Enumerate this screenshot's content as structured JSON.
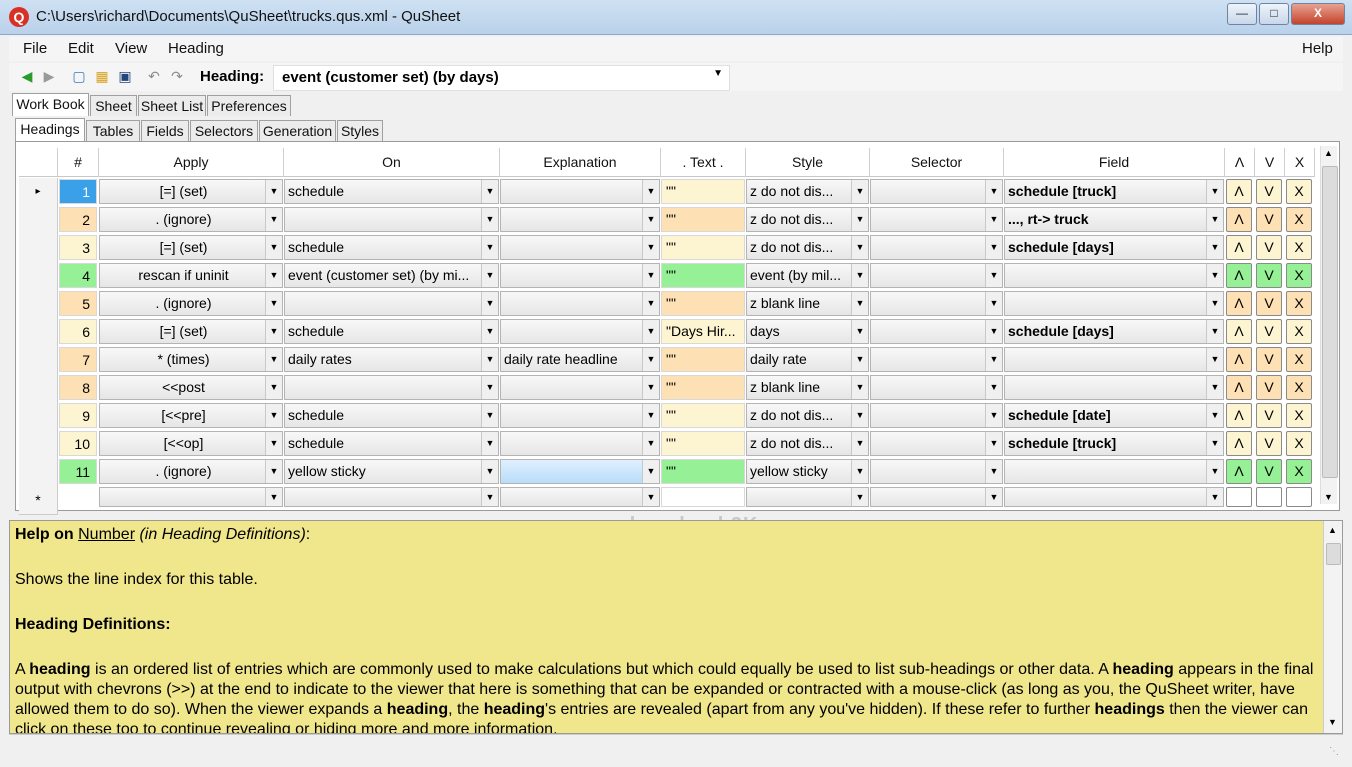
{
  "window": {
    "title": "C:\\Users\\richard\\Documents\\QuSheet\\trucks.qus.xml - QuSheet",
    "min": "—",
    "max": "□",
    "close": "X"
  },
  "app_icon": "Q",
  "menu": {
    "file": "File",
    "edit": "Edit",
    "view": "View",
    "heading": "Heading",
    "help": "Help"
  },
  "toolbar": {
    "icons": [
      "back-arrow-icon",
      "forward-arrow-icon",
      "new-file-icon",
      "open-folder-icon",
      "save-disk-icon",
      "undo-icon",
      "redo-icon"
    ],
    "heading_label": "Heading:",
    "heading_value": "event (customer set) (by days)"
  },
  "tabs_top": [
    "Work Book",
    "Sheet",
    "Sheet List",
    "Preferences"
  ],
  "tabs_sub": [
    "Headings",
    "Tables",
    "Fields",
    "Selectors",
    "Generation",
    "Styles"
  ],
  "grid": {
    "columns": [
      "#",
      "Apply",
      "On",
      "Explanation",
      ". Text .",
      "Style",
      "Selector",
      "Field",
      "Λ",
      "V",
      "X"
    ],
    "rows": [
      {
        "num": "1",
        "apply": "[=] (set)",
        "on": "schedule",
        "expl": "",
        "text": "\"\"",
        "style": "z do not dis...",
        "sel": "",
        "field": "schedule [truck]",
        "color": "yellow"
      },
      {
        "num": "2",
        "apply": ". (ignore)",
        "on": "",
        "expl": "",
        "text": "\"\"",
        "style": "z do not dis...",
        "sel": "",
        "field": "..., rt-> truck",
        "color": "orange"
      },
      {
        "num": "3",
        "apply": "[=] (set)",
        "on": "schedule",
        "expl": "",
        "text": "\"\"",
        "style": "z do not dis...",
        "sel": "",
        "field": "schedule [days]",
        "color": "yellow"
      },
      {
        "num": "4",
        "apply": "rescan if uninit",
        "on": "event (customer set) (by mi...",
        "expl": "",
        "text": "\"\"",
        "style": "event (by mil...",
        "sel": "",
        "field": "",
        "color": "green"
      },
      {
        "num": "5",
        "apply": ". (ignore)",
        "on": "",
        "expl": "",
        "text": "\"\"",
        "style": "z blank line",
        "sel": "",
        "field": "",
        "color": "orange"
      },
      {
        "num": "6",
        "apply": "[=] (set)",
        "on": "schedule",
        "expl": "",
        "text": "\"Days Hir...",
        "style": "days",
        "sel": "",
        "field": "schedule [days]",
        "color": "yellow"
      },
      {
        "num": "7",
        "apply": "* (times)",
        "on": "daily rates",
        "expl": "daily rate headline",
        "text": "\"\"",
        "style": "daily rate",
        "sel": "",
        "field": "",
        "color": "orange"
      },
      {
        "num": "8",
        "apply": "<<post",
        "on": "",
        "expl": "",
        "text": "\"\"",
        "style": "z blank line",
        "sel": "",
        "field": "",
        "color": "orange"
      },
      {
        "num": "9",
        "apply": "[<<pre]",
        "on": "schedule",
        "expl": "",
        "text": "\"\"",
        "style": "z do not dis...",
        "sel": "",
        "field": "schedule [date]",
        "color": "yellow"
      },
      {
        "num": "10",
        "apply": "[<<op]",
        "on": "schedule",
        "expl": "",
        "text": "\"\"",
        "style": "z do not dis...",
        "sel": "",
        "field": "schedule [truck]",
        "color": "yellow"
      },
      {
        "num": "11",
        "apply": ". (ignore)",
        "on": "yellow sticky",
        "expl": "",
        "text": "\"\"",
        "style": "yellow sticky",
        "sel": "",
        "field": "",
        "color": "green"
      }
    ],
    "new_row_marker": "*",
    "current_row_marker": "▸",
    "btn_up": "Λ",
    "btn_down": "V",
    "btn_delete": "X"
  },
  "colors": {
    "yellow": "#fdf5d2",
    "orange": "#fde0b4",
    "green": "#96f096",
    "selected_num": "#3aa0e8",
    "help_bg": "#f0e68c"
  },
  "watermark": "download 3K",
  "help": {
    "title_prefix": "Help on ",
    "title_link": "Number",
    "title_italic": " (in Heading Definitions)",
    "title_colon": ":",
    "line1": "Shows the line index for this table.",
    "section": "Heading Definitions:",
    "para_a1": "A ",
    "para_b1": "heading",
    "para_a2": " is an ordered list of entries which are commonly used to make calculations but which could equally be used to list sub-headings or other data. A ",
    "para_b2": "heading",
    "para_a3": " appears in the final output with chevrons (>>) at the end to indicate to the viewer that here is something that can be expanded or contracted with a mouse-click (as long as you, the QuSheet writer, have allowed them to do so). When the viewer expands a ",
    "para_b3": "heading",
    "para_a4": ", the ",
    "para_b4": "heading",
    "para_a5": "'s entries are revealed (apart from any you've hidden). If these refer to further ",
    "para_b5": "headings",
    "para_a6": " then the viewer can click on these too to continue revealing or hiding more and more information."
  }
}
